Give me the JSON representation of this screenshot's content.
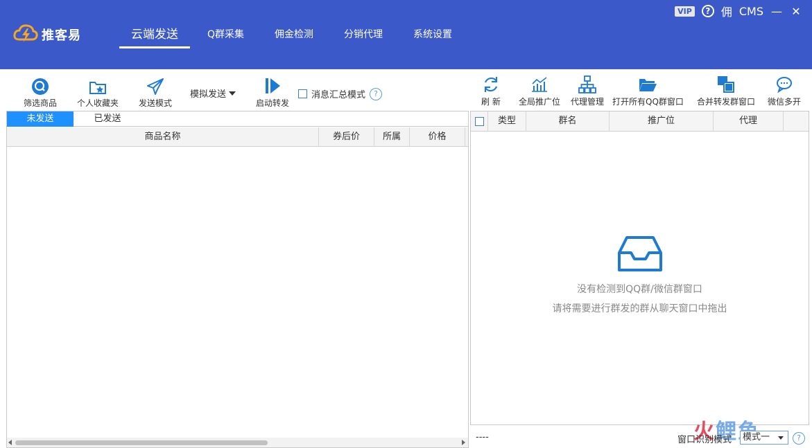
{
  "app": {
    "logo_text": "推客易",
    "vip_label": "VIP",
    "help_symbol": "?",
    "commission_label": "佣",
    "cms_label": "CMS",
    "minimize_symbol": "—",
    "close_symbol": "✕"
  },
  "nav": {
    "items": [
      {
        "label": "云端发送",
        "active": true
      },
      {
        "label": "Q群采集"
      },
      {
        "label": "佣金检测"
      },
      {
        "label": "分销代理"
      },
      {
        "label": "系统设置"
      }
    ]
  },
  "toolbar_left": {
    "filter_goods": "筛选商品",
    "favorites": "个人收藏夹",
    "send_mode": "发送模式",
    "simulate_send": "模拟发送",
    "start_forward": "启动转发",
    "msg_summary": "消息汇总模式",
    "help_symbol": "?"
  },
  "toolbar_right": {
    "refresh": "刷 新",
    "global_promo": "全局推广位",
    "agent_manage": "代理管理",
    "open_qq": "打开所有QQ群窗口",
    "merge_windows": "合并转发群窗口",
    "wechat_multi": "微信多开"
  },
  "left_panel": {
    "tabs": [
      "未发送",
      "已发送"
    ],
    "columns": [
      "商品名称",
      "券后价",
      "所属",
      "价格"
    ]
  },
  "right_panel": {
    "columns": [
      "类型",
      "群名",
      "推广位",
      "代理"
    ],
    "empty_line1": "没有检测到QQ群/微信群窗口",
    "empty_line2": "请将需要进行群发的群从聊天窗口中拖出"
  },
  "footer": {
    "status": "----",
    "mode_label": "窗口识别模式",
    "mode_value": "模式一",
    "help_symbol": "?"
  },
  "watermark": {
    "part1": "火",
    "part2": "鲤鱼"
  },
  "colors": {
    "header_bg": "#3b59c8",
    "accent_blue": "#1e90ff",
    "icon_blue": "#1f7ad1",
    "logo_orange": "#f5a623"
  },
  "icons": {
    "logo": "lightning-cloud-icon",
    "filter": "search-circle-icon",
    "favorites": "folder-star-icon",
    "send_mode": "paper-plane-icon",
    "start_forward": "play-icon",
    "refresh": "refresh-icon",
    "global_promo": "chart-icon",
    "agent_manage": "org-chart-icon",
    "open_qq": "open-folder-icon",
    "merge": "merge-windows-icon",
    "wechat": "chat-bubble-icon",
    "empty": "inbox-icon"
  }
}
